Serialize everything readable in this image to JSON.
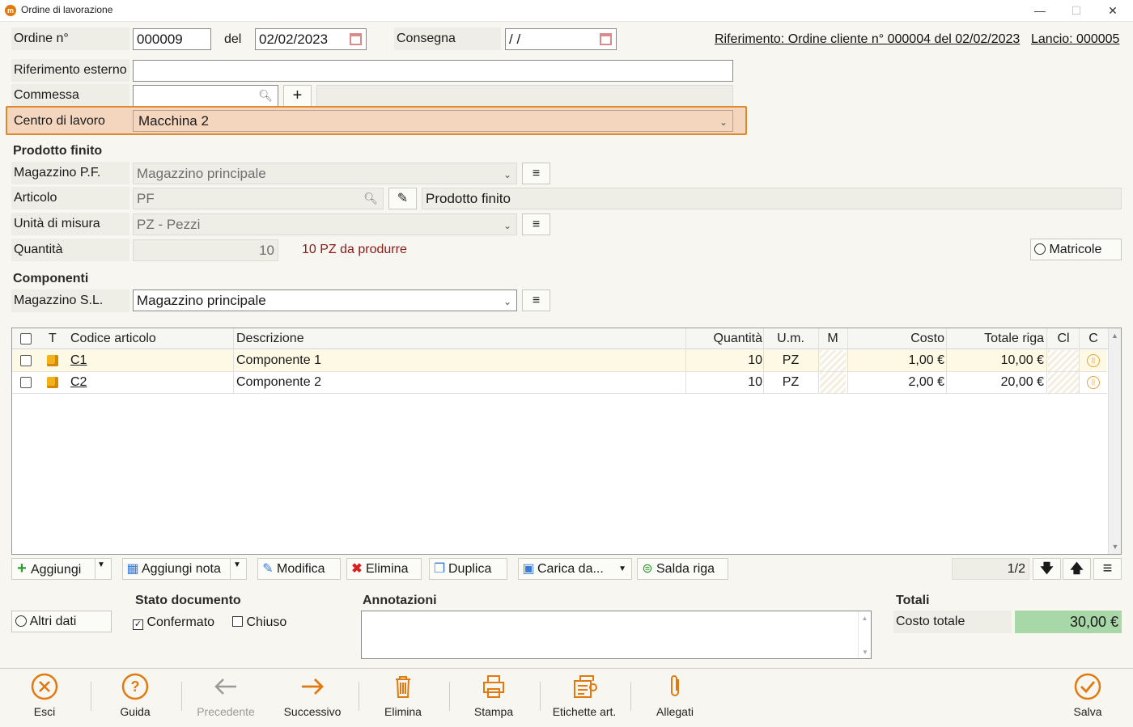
{
  "window": {
    "title": "Ordine di lavorazione",
    "minimize": "—",
    "maximize": "☐",
    "close": "✕"
  },
  "header": {
    "ordine_label": "Ordine n°",
    "ordine_value": "000009",
    "del_label": "del",
    "del_value": "02/02/2023",
    "consegna_label": "Consegna",
    "consegna_value": " /  /",
    "riferimento_link": "Riferimento: Ordine cliente n° 000004 del 02/02/2023",
    "lancio_link": "Lancio: 000005",
    "rif_esterno_label": "Riferimento esterno",
    "rif_esterno_value": "",
    "commessa_label": "Commessa",
    "commessa_value": "",
    "centro_label": "Centro di lavoro",
    "centro_value": "Macchina 2"
  },
  "prodotto": {
    "title": "Prodotto finito",
    "magazzino_label": "Magazzino P.F.",
    "magazzino_value": "Magazzino principale",
    "articolo_label": "Articolo",
    "articolo_value": "PF",
    "articolo_desc": "Prodotto finito",
    "um_label": "Unità di misura",
    "um_value": "PZ - Pezzi",
    "quantita_label": "Quantità",
    "quantita_value": "10",
    "quantita_note": "10 PZ da produrre",
    "matricole_label": "Matricole"
  },
  "componenti": {
    "title": "Componenti",
    "magazzino_label": "Magazzino S.L.",
    "magazzino_value": "Magazzino principale"
  },
  "grid": {
    "headers": {
      "t": "T",
      "codice": "Codice articolo",
      "descrizione": "Descrizione",
      "quantita": "Quantità",
      "um": "U.m.",
      "m": "M",
      "costo": "Costo",
      "totale": "Totale riga",
      "cl": "Cl",
      "c": "C"
    },
    "rows": [
      {
        "codice": "C1",
        "descrizione": "Componente 1",
        "quantita": "10",
        "um": "PZ",
        "costo": "1,00 €",
        "totale": "10,00 €"
      },
      {
        "codice": "C2",
        "descrizione": "Componente 2",
        "quantita": "10",
        "um": "PZ",
        "costo": "2,00 €",
        "totale": "20,00 €"
      }
    ]
  },
  "toolbar": {
    "aggiungi": "Aggiungi",
    "aggiungi_nota": "Aggiungi nota",
    "modifica": "Modifica",
    "elimina": "Elimina",
    "duplica": "Duplica",
    "carica": "Carica da...",
    "salda": "Salda riga",
    "pager": "1/2"
  },
  "footer": {
    "altri_dati": "Altri dati",
    "stato_title": "Stato documento",
    "confermato": "Confermato",
    "chiuso": "Chiuso",
    "annotazioni_title": "Annotazioni",
    "annotazioni_value": "",
    "totali_title": "Totali",
    "costo_totale_label": "Costo totale",
    "costo_totale_value": "30,00 €"
  },
  "bottom": {
    "esci": "Esci",
    "guida": "Guida",
    "precedente": "Precedente",
    "successivo": "Successivo",
    "elimina": "Elimina",
    "stampa": "Stampa",
    "etichette": "Etichette art.",
    "allegati": "Allegati",
    "salva": "Salva"
  },
  "colors": {
    "accent": "#e07a10",
    "highlight_bg": "#f4d6bf",
    "total_bg": "#a8d8a8",
    "note_red": "#8b1a1a"
  }
}
